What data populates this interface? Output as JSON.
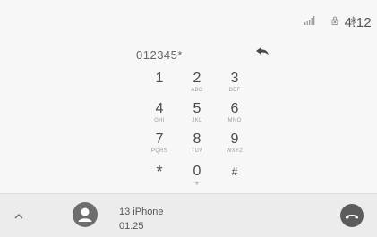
{
  "status": {
    "time": "4:12",
    "icons": [
      "signal-bars-icon",
      "battery-lock-icon",
      "bluetooth-icon"
    ]
  },
  "dialer": {
    "number": "012345*",
    "backspace_icon": "backspace-arrow-icon"
  },
  "keypad": {
    "keys": [
      {
        "digit": "1",
        "letters": ""
      },
      {
        "digit": "2",
        "letters": "ABC"
      },
      {
        "digit": "3",
        "letters": "DEF"
      },
      {
        "digit": "4",
        "letters": "GHI"
      },
      {
        "digit": "5",
        "letters": "JKL"
      },
      {
        "digit": "6",
        "letters": "MNO"
      },
      {
        "digit": "7",
        "letters": "PQRS"
      },
      {
        "digit": "8",
        "letters": "TUV"
      },
      {
        "digit": "9",
        "letters": "WXYZ"
      },
      {
        "digit": "*",
        "letters": ""
      },
      {
        "digit": "0",
        "letters": "+"
      },
      {
        "digit": "#",
        "letters": ""
      }
    ]
  },
  "call": {
    "caller": "13 iPhone",
    "duration": "01:25",
    "avatar_icon": "person-icon",
    "end_icon": "end-call-icon",
    "expand_icon": "chevron-up-icon"
  }
}
